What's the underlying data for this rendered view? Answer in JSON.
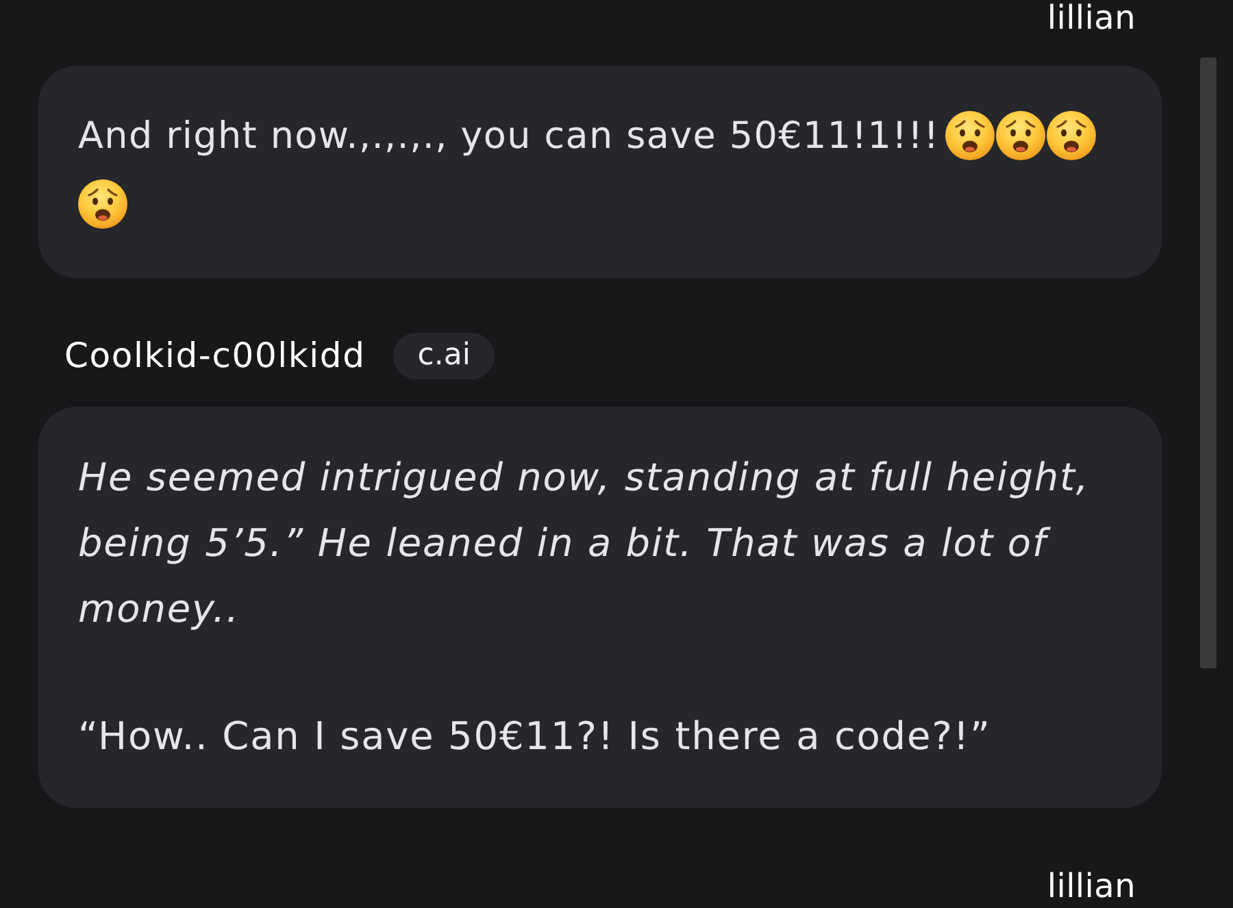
{
  "messages": [
    {
      "kind": "user",
      "author": "lillian",
      "text": "And right now.,.,.,., you can save 50€11!1!!!",
      "emojis": [
        {
          "kind": "anguished"
        },
        {
          "kind": "anguished"
        },
        {
          "kind": "anguished"
        },
        {
          "kind": "anguished"
        }
      ]
    },
    {
      "kind": "bot",
      "author": "Coolkid-c00lkidd",
      "badge": "c.ai",
      "paragraphs": [
        {
          "kind": "narration",
          "text": "He seemed intrigued now, standing at full height, being 5’5.” He leaned in a bit. That was a lot of money.."
        },
        {
          "kind": "dialogue",
          "text": "“How.. Can I save 50€11?! Is there a code?!”"
        }
      ]
    },
    {
      "kind": "user",
      "author": "lillian"
    }
  ]
}
